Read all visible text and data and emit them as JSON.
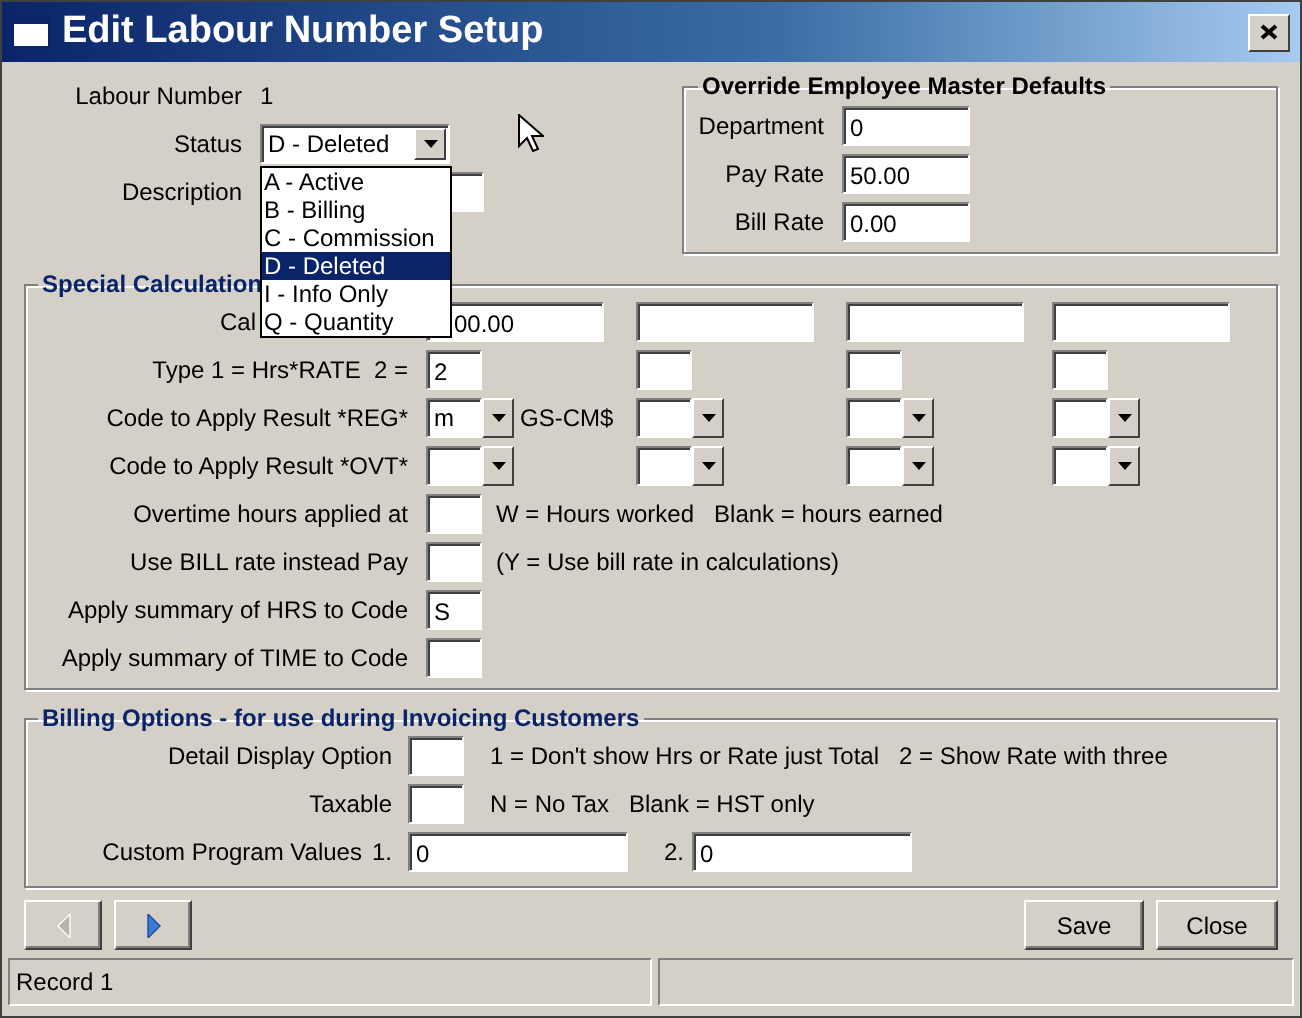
{
  "window": {
    "title": "Edit Labour Number Setup"
  },
  "header": {
    "labour_number": {
      "label": "Labour Number",
      "value": "1"
    },
    "status": {
      "label": "Status",
      "value": "D - Deleted",
      "expanded": true,
      "options": [
        {
          "label": "A - Active",
          "selected": false
        },
        {
          "label": "B - Billing",
          "selected": false
        },
        {
          "label": "C - Commission",
          "selected": false
        },
        {
          "label": "D - Deleted",
          "selected": true
        },
        {
          "label": "I - Info Only",
          "selected": false
        },
        {
          "label": "Q - Quantity",
          "selected": false
        }
      ]
    },
    "description": {
      "label": "Description"
    }
  },
  "override": {
    "title": "Override Employee Master Defaults",
    "fields": [
      {
        "label": "Department",
        "value": "0"
      },
      {
        "label": "Pay Rate",
        "value": "50.00"
      },
      {
        "label": "Bill Rate",
        "value": "0.00"
      }
    ]
  },
  "special": {
    "title": "Special Calculation",
    "rows": [
      {
        "label": "Cal",
        "kind": "wide",
        "cells": [
          {
            "value": "00.00"
          },
          {},
          {},
          {}
        ]
      },
      {
        "label": "Type 1 = Hrs*RATE  2 =",
        "kind": "small",
        "cells": [
          {
            "value": "2"
          },
          {},
          {},
          {}
        ]
      },
      {
        "label": "Code to Apply Result *REG*",
        "kind": "combo",
        "cells": [
          {
            "value": "m",
            "note": "GS-CM$"
          },
          {},
          {},
          {}
        ]
      },
      {
        "label": "Code to Apply Result *OVT*",
        "kind": "combo",
        "cells": [
          {},
          {},
          {},
          {}
        ]
      },
      {
        "label": "Overtime hours applied at",
        "kind": "small",
        "cells": [
          {
            "note": "W = Hours worked   Blank = hours earned"
          }
        ]
      },
      {
        "label": "Use BILL rate instead Pay",
        "kind": "small",
        "cells": [
          {
            "note": "(Y = Use bill rate in calculations)"
          }
        ]
      },
      {
        "label": "Apply summary of HRS to Code",
        "kind": "small",
        "cells": [
          {
            "value": "S"
          }
        ]
      },
      {
        "label": "Apply summary of TIME to Code",
        "kind": "small",
        "cells": [
          {}
        ]
      }
    ]
  },
  "billing": {
    "title": "Billing Options - for use during Invoicing Customers",
    "rows": [
      {
        "label": "Detail Display Option",
        "kind": "small",
        "cells": [
          {
            "note": "1 = Don't show Hrs or Rate just Total   2 = Show Rate with three"
          }
        ]
      },
      {
        "label": "Taxable",
        "kind": "small",
        "cells": [
          {
            "note": "N = No Tax   Blank = HST only"
          }
        ]
      },
      {
        "label": "Custom Program Values",
        "kind": "pair",
        "cells": [
          {
            "prefix": "1.",
            "value": "0"
          },
          {
            "prefix": "2.",
            "value": "0"
          }
        ]
      }
    ]
  },
  "nav": [
    {
      "kind": "previous",
      "disabled": true
    },
    {
      "kind": "next",
      "disabled": false
    }
  ],
  "buttons": [
    {
      "label": "Save"
    },
    {
      "label": "Close"
    }
  ],
  "status_bar": {
    "text": "Record 1"
  }
}
